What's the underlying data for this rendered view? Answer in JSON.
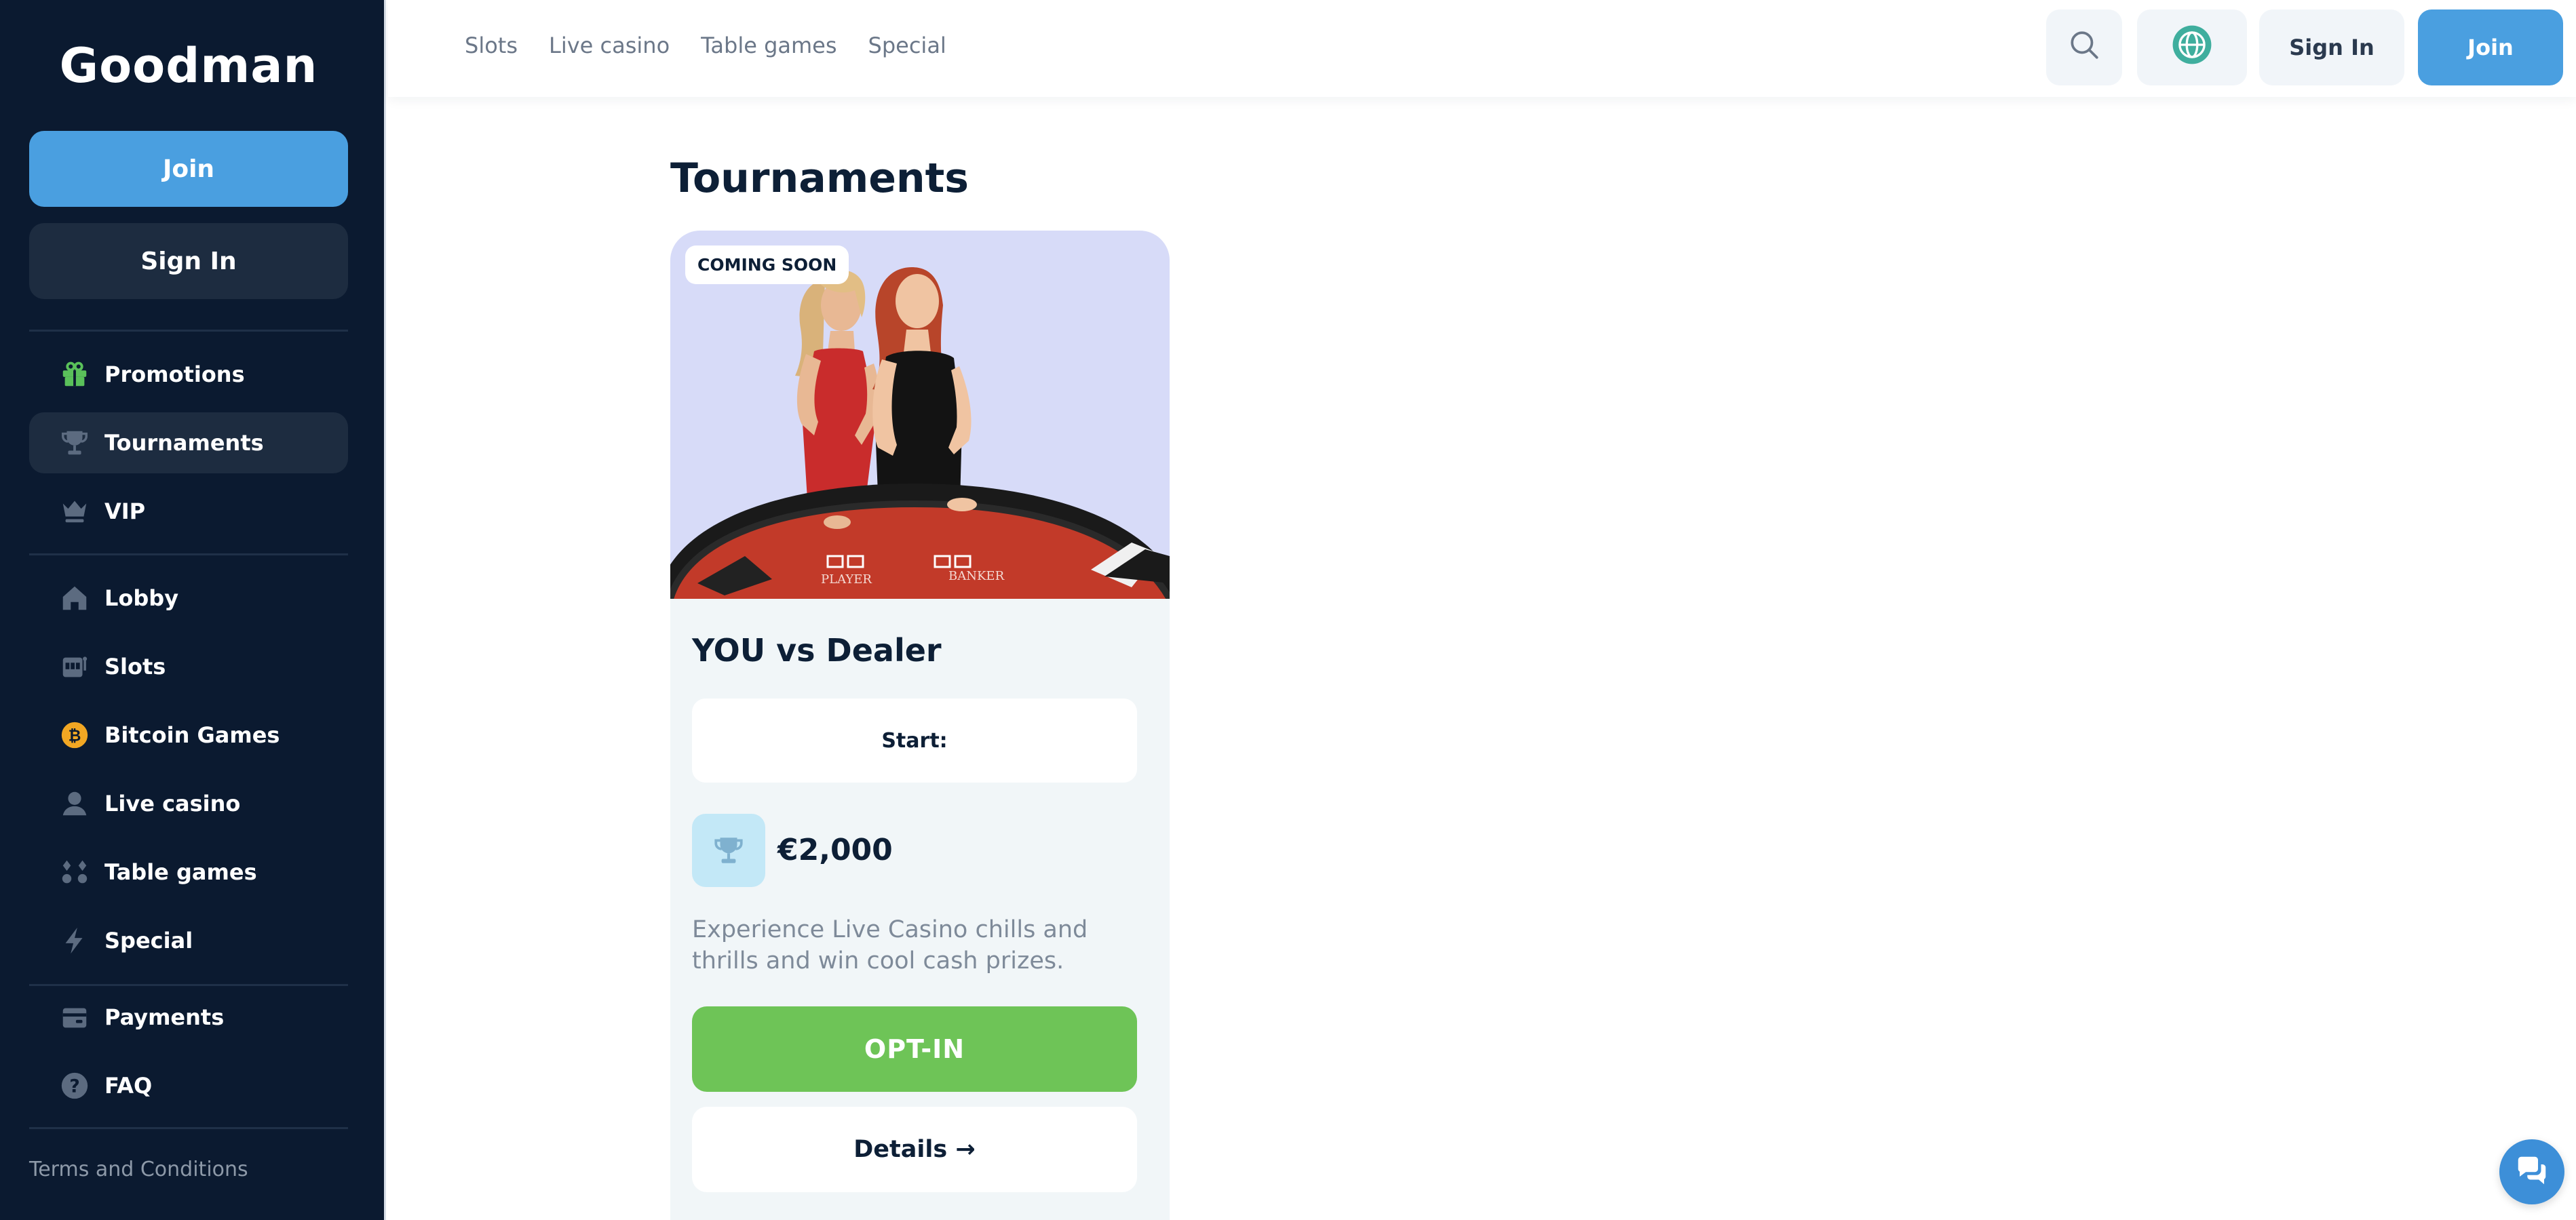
{
  "brand": {
    "logo_text": "Goodman"
  },
  "sidebar": {
    "join_label": "Join",
    "signin_label": "Sign In",
    "items": [
      {
        "label": "Promotions",
        "icon": "gift-icon"
      },
      {
        "label": "Tournaments",
        "icon": "trophy-icon",
        "active": true
      },
      {
        "label": "VIP",
        "icon": "vip-icon"
      },
      {
        "label": "Lobby",
        "icon": "home-icon"
      },
      {
        "label": "Slots",
        "icon": "slot-machine-icon"
      },
      {
        "label": "Bitcoin Games",
        "icon": "bitcoin-icon"
      },
      {
        "label": "Live casino",
        "icon": "dealer-icon"
      },
      {
        "label": "Table games",
        "icon": "cards-icon"
      },
      {
        "label": "Special",
        "icon": "lightning-icon"
      },
      {
        "label": "Payments",
        "icon": "wallet-icon"
      },
      {
        "label": "FAQ",
        "icon": "question-icon"
      }
    ],
    "terms_label": "Terms and Conditions"
  },
  "topbar": {
    "nav": [
      "Slots",
      "Live casino",
      "Table games",
      "Special"
    ],
    "search_icon": "search-icon",
    "language_icon": "globe-icon",
    "signin_label": "Sign In",
    "join_label": "Join"
  },
  "main": {
    "title": "Tournaments",
    "tournament": {
      "badge": "COMING SOON",
      "name": "YOU vs Dealer",
      "start_label": "Start:",
      "prize": "€2,000",
      "description": "Experience Live Casino chills and thrills and win cool cash prizes.",
      "optin_label": "OPT-IN",
      "details_label": "Details →",
      "table_labels": [
        "PLAYER",
        "BANKER"
      ]
    }
  },
  "colors": {
    "sidebar_bg": "#0b1a30",
    "accent_blue": "#4a9fe0",
    "optin_green": "#6ec457",
    "card_bg": "#f1f6f8"
  }
}
